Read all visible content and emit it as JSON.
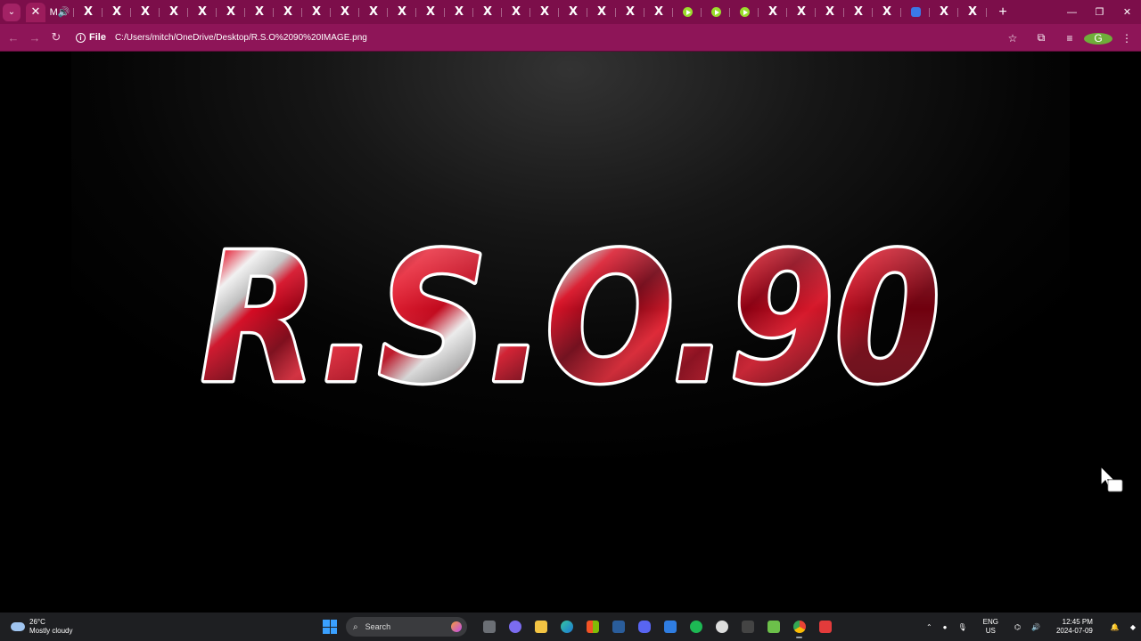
{
  "browser": {
    "tab_count_x": 30,
    "new_tab_label": "+",
    "search_tabs_label": "⌄",
    "window_controls": {
      "minimize": "—",
      "restore": "❐",
      "close": "✕"
    },
    "site_label": "File",
    "url": "C:/Users/mitch/OneDrive/Desktop/R.S.O%2090%20IMAGE.png",
    "profile_initial": "G"
  },
  "content": {
    "logo_text": "R.S.O.90",
    "colors": {
      "red_dark": "#7a0010",
      "red": "#d40a22",
      "silver": "#e6e6e6",
      "outline": "#ffffff"
    }
  },
  "taskbar": {
    "weather_temp": "26°C",
    "weather_desc": "Mostly cloudy",
    "search_label": "Search",
    "lang_top": "ENG",
    "lang_bottom": "US",
    "time": "12:45 PM",
    "date": "2024-07-09"
  }
}
